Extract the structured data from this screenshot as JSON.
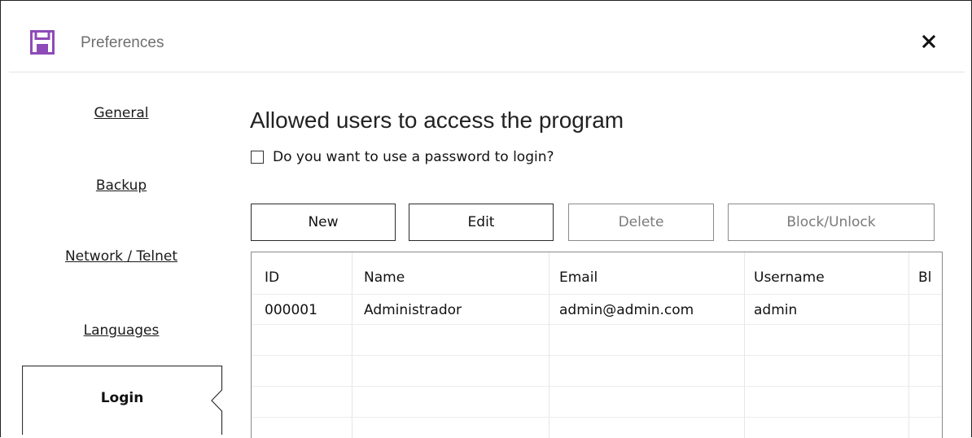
{
  "window": {
    "title": "Preferences",
    "close_icon": "close-icon",
    "app_icon": "save-icon",
    "accent": "#8e4bb7"
  },
  "sidebar": {
    "items": [
      {
        "label": "General"
      },
      {
        "label": "Backup"
      },
      {
        "label": "Network / Telnet"
      },
      {
        "label": "Languages"
      },
      {
        "label": "Login",
        "selected": true
      }
    ]
  },
  "main": {
    "heading": "Allowed users to access the program",
    "password_checkbox": {
      "label": "Do you want to use a password to login?",
      "checked": false
    },
    "buttons": {
      "new": "New",
      "edit": "Edit",
      "delete": "Delete",
      "block": "Block/Unlock"
    },
    "table": {
      "columns": [
        "ID",
        "Name",
        "Email",
        "Username",
        "Bl"
      ],
      "rows": [
        [
          "000001",
          "Administrador",
          "admin@admin.com",
          "admin",
          ""
        ]
      ]
    }
  }
}
